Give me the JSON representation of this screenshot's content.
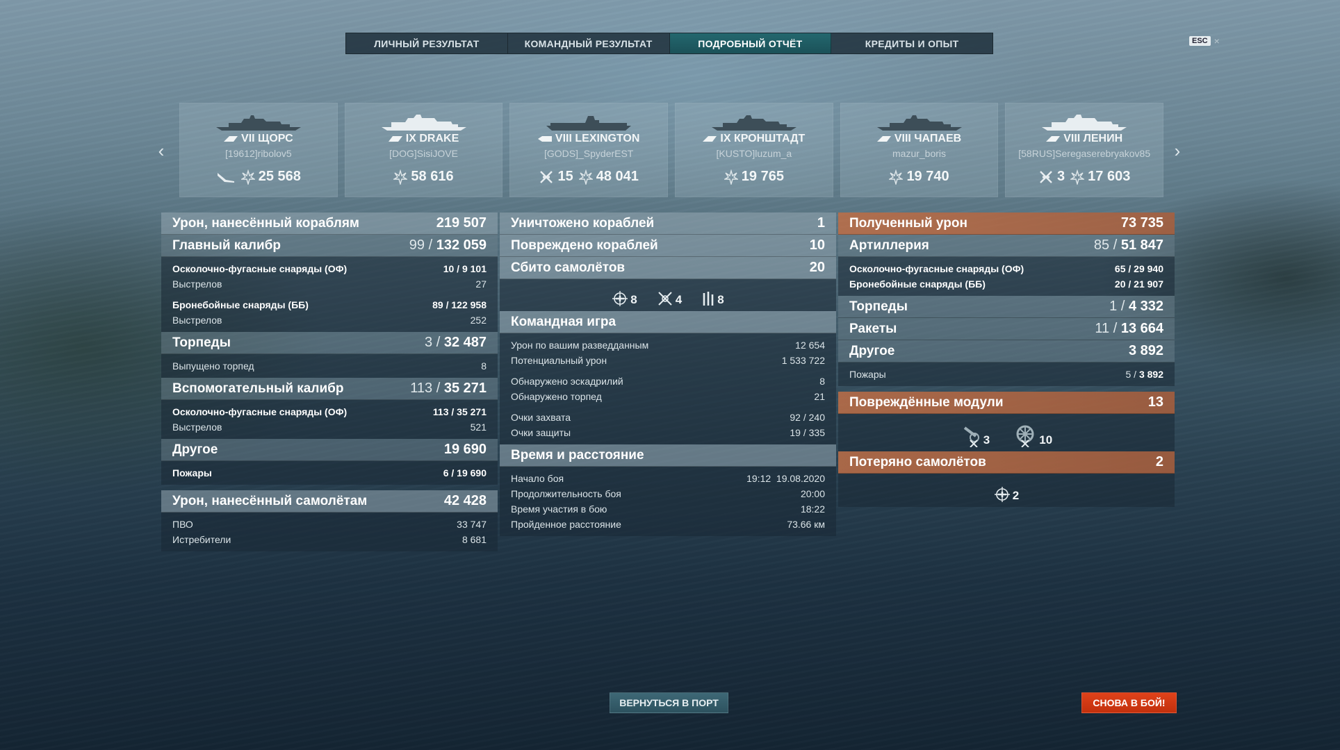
{
  "tabs": [
    {
      "label": "ЛИЧНЫЙ РЕЗУЛЬТАТ"
    },
    {
      "label": "КОМАНДНЫЙ РЕЗУЛЬТАТ"
    },
    {
      "label": "ПОДРОБНЫЙ ОТЧЁТ"
    },
    {
      "label": "КРЕДИТЫ И ОПЫТ"
    }
  ],
  "esc": {
    "key": "ESC",
    "close": "×"
  },
  "ships": [
    {
      "name": "VII ЩОРС",
      "player": "[19612]ribolov5",
      "kills": "",
      "damage": "25 568"
    },
    {
      "name": "IX DRAKE",
      "player": "[DOG]SisiJOVE",
      "kills": "",
      "damage": "58 616"
    },
    {
      "name": "VIII LEXINGTON",
      "player": "[GODS]_SpyderEST",
      "kills": "15",
      "damage": "48 041"
    },
    {
      "name": "IX КРОНШТАДТ",
      "player": "[KUSTO]luzum_a",
      "kills": "",
      "damage": "19 765"
    },
    {
      "name": "VIII ЧАПАЕВ",
      "player": "mazur_boris",
      "kills": "",
      "damage": "19 740"
    },
    {
      "name": "VIII ЛЕНИН",
      "player": "[58RUS]Seregaserebryakov85",
      "kills": "3",
      "damage": "17 603"
    }
  ],
  "col1": {
    "ship_damage": {
      "label": "Урон, нанесённый кораблям",
      "value": "219 507"
    },
    "main": {
      "label": "Главный калибр",
      "hits": "99",
      "value": "132 059"
    },
    "main_he": {
      "label": "Осколочно-фугасные снаряды (ОФ)",
      "hits": "10",
      "value": "9 101"
    },
    "main_he_shots": {
      "label": "Выстрелов",
      "value": "27"
    },
    "main_ap": {
      "label": "Бронебойные снаряды (ББ)",
      "hits": "89",
      "value": "122 958"
    },
    "main_ap_shots": {
      "label": "Выстрелов",
      "value": "252"
    },
    "torp": {
      "label": "Торпеды",
      "hits": "3",
      "value": "32 487"
    },
    "torp_fired": {
      "label": "Выпущено торпед",
      "value": "8"
    },
    "sec": {
      "label": "Вспомогательный калибр",
      "hits": "113",
      "value": "35 271"
    },
    "sec_he": {
      "label": "Осколочно-фугасные снаряды (ОФ)",
      "hits": "113",
      "value": "35 271"
    },
    "sec_shots": {
      "label": "Выстрелов",
      "value": "521"
    },
    "other": {
      "label": "Другое",
      "value": "19 690"
    },
    "fires": {
      "label": "Пожары",
      "hits": "6",
      "value": "19 690"
    },
    "plane_damage": {
      "label": "Урон, нанесённый самолётам",
      "value": "42 428"
    },
    "aa": {
      "label": "ПВО",
      "value": "33 747"
    },
    "fighters": {
      "label": "Истребители",
      "value": "8 681"
    }
  },
  "col2": {
    "destroyed": {
      "label": "Уничтожено кораблей",
      "value": "1"
    },
    "damaged": {
      "label": "Повреждено кораблей",
      "value": "10"
    },
    "planes_shot": {
      "label": "Сбито самолётов",
      "value": "20"
    },
    "planes_icons": [
      {
        "icon": "crosshair-plane-icon",
        "value": "8"
      },
      {
        "icon": "fighter-plane-icon",
        "value": "4"
      },
      {
        "icon": "squadron-bars-icon",
        "value": "8"
      }
    ],
    "team": {
      "label": "Командная игра"
    },
    "spot_damage": {
      "label": "Урон по вашим разведданным",
      "value": "12 654"
    },
    "potential": {
      "label": "Потенциальный урон",
      "value": "1 533 722"
    },
    "spot_squad": {
      "label": "Обнаружено эскадрилий",
      "value": "8"
    },
    "spot_torp": {
      "label": "Обнаружено торпед",
      "value": "21"
    },
    "capture": {
      "label": "Очки захвата",
      "value": "92 / 240"
    },
    "defense": {
      "label": "Очки защиты",
      "value": "19 / 335"
    },
    "time": {
      "label": "Время и расстояние"
    },
    "start": {
      "label": "Начало боя",
      "value": "19:12  19.08.2020"
    },
    "duration": {
      "label": "Продолжительность боя",
      "value": "20:00"
    },
    "participation": {
      "label": "Время участия в бою",
      "value": "18:22"
    },
    "distance": {
      "label": "Пройденное расстояние",
      "value": "73.66 км"
    }
  },
  "col3": {
    "received": {
      "label": "Полученный урон",
      "value": "73 735"
    },
    "art": {
      "label": "Артиллерия",
      "hits": "85",
      "value": "51 847"
    },
    "art_he": {
      "label": "Осколочно-фугасные снаряды (ОФ)",
      "hits": "65",
      "value": "29 940"
    },
    "art_ap": {
      "label": "Бронебойные снаряды (ББ)",
      "hits": "20",
      "value": "21 907"
    },
    "torp": {
      "label": "Торпеды",
      "hits": "1",
      "value": "4 332"
    },
    "rockets": {
      "label": "Ракеты",
      "hits": "11",
      "value": "13 664"
    },
    "other": {
      "label": "Другое",
      "value": "3 892"
    },
    "fires": {
      "label": "Пожары",
      "hits": "5",
      "value": "3 892"
    },
    "modules": {
      "label": "Повреждённые модули",
      "value": "13"
    },
    "module_icons": [
      {
        "icon": "gun-module-icon",
        "value": "3"
      },
      {
        "icon": "engine-module-icon",
        "value": "10"
      }
    ],
    "planes_lost": {
      "label": "Потеряно самолётов",
      "value": "2"
    },
    "planes_lost_icons": [
      {
        "icon": "crosshair-plane-icon",
        "value": "2"
      }
    ]
  },
  "buttons": {
    "port": "ВЕРНУТЬСЯ В ПОРТ",
    "battle": "СНОВА В БОЙ!"
  },
  "colors": {
    "accent_tab": "#1b5158",
    "battle_button": "#d2381a",
    "orange_header": "#b8683f"
  }
}
